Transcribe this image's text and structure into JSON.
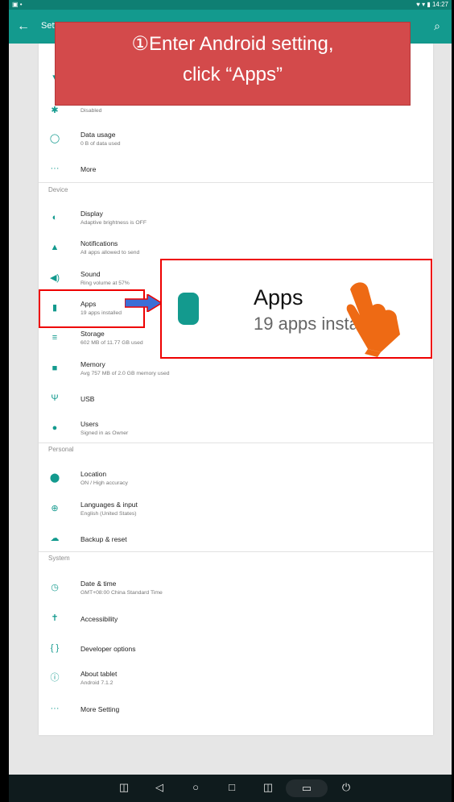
{
  "statusbar": {
    "left": "▣ •",
    "right": "♥ ▾ ▮ 14:27"
  },
  "appbar": {
    "back": "←",
    "title": "Sett",
    "search": "⌕"
  },
  "banner": {
    "line1": "①Enter Android setting,",
    "line2": "click “Apps”"
  },
  "sections": {
    "device": "Device",
    "personal": "Personal",
    "system": "System"
  },
  "rows": [
    {
      "name": "wireless",
      "title": "",
      "subtitle": "",
      "icon": "wifi"
    },
    {
      "name": "bluetooth",
      "title": "",
      "subtitle": "Disabled",
      "icon": "bluetooth"
    },
    {
      "name": "data-usage",
      "title": "Data usage",
      "subtitle": "0 B of data used",
      "icon": "data-usage"
    },
    {
      "name": "more",
      "title": "More",
      "subtitle": "",
      "icon": "more"
    },
    {
      "name": "display",
      "title": "Display",
      "subtitle": "Adaptive brightness is OFF",
      "icon": "display"
    },
    {
      "name": "notifications",
      "title": "Notifications",
      "subtitle": "All apps allowed to send",
      "icon": "bell"
    },
    {
      "name": "sound",
      "title": "Sound",
      "subtitle": "Ring volume at 57%",
      "icon": "sound"
    },
    {
      "name": "apps",
      "title": "Apps",
      "subtitle": "19 apps installed",
      "icon": "android"
    },
    {
      "name": "storage",
      "title": "Storage",
      "subtitle": "602 MB of 11.77 GB used",
      "icon": "storage"
    },
    {
      "name": "memory",
      "title": "Memory",
      "subtitle": "Avg 757 MB of 2.0 GB memory used",
      "icon": "memory"
    },
    {
      "name": "usb",
      "title": "USB",
      "subtitle": "",
      "icon": "usb"
    },
    {
      "name": "users",
      "title": "Users",
      "subtitle": "Signed in as Owner",
      "icon": "user"
    },
    {
      "name": "location",
      "title": "Location",
      "subtitle": "ON / High accuracy",
      "icon": "location"
    },
    {
      "name": "languages",
      "title": "Languages & input",
      "subtitle": "English (United States)",
      "icon": "globe"
    },
    {
      "name": "backup",
      "title": "Backup & reset",
      "subtitle": "",
      "icon": "cloud"
    },
    {
      "name": "date-time",
      "title": "Date & time",
      "subtitle": "GMT+08:00 China Standard Time",
      "icon": "clock"
    },
    {
      "name": "accessibility",
      "title": "Accessibility",
      "subtitle": "",
      "icon": "accessibility"
    },
    {
      "name": "developer-options",
      "title": "Developer options",
      "subtitle": "",
      "icon": "braces"
    },
    {
      "name": "about-tablet",
      "title": "About tablet",
      "subtitle": "Android 7.1.2",
      "icon": "info"
    },
    {
      "name": "more-setting",
      "title": "More Setting",
      "subtitle": "",
      "icon": "more"
    }
  ],
  "callout": {
    "title": "Apps",
    "subtitle": "19 apps installed"
  },
  "sysnav": {
    "b1": "◫",
    "b2": "◁",
    "b3": "○",
    "b4": "□",
    "b5": "◫",
    "b6": "▭",
    "b7": "⏻"
  },
  "colors": {
    "teal": "#139a8e",
    "banner": "#d34a4b",
    "highlight": "#e00000"
  }
}
